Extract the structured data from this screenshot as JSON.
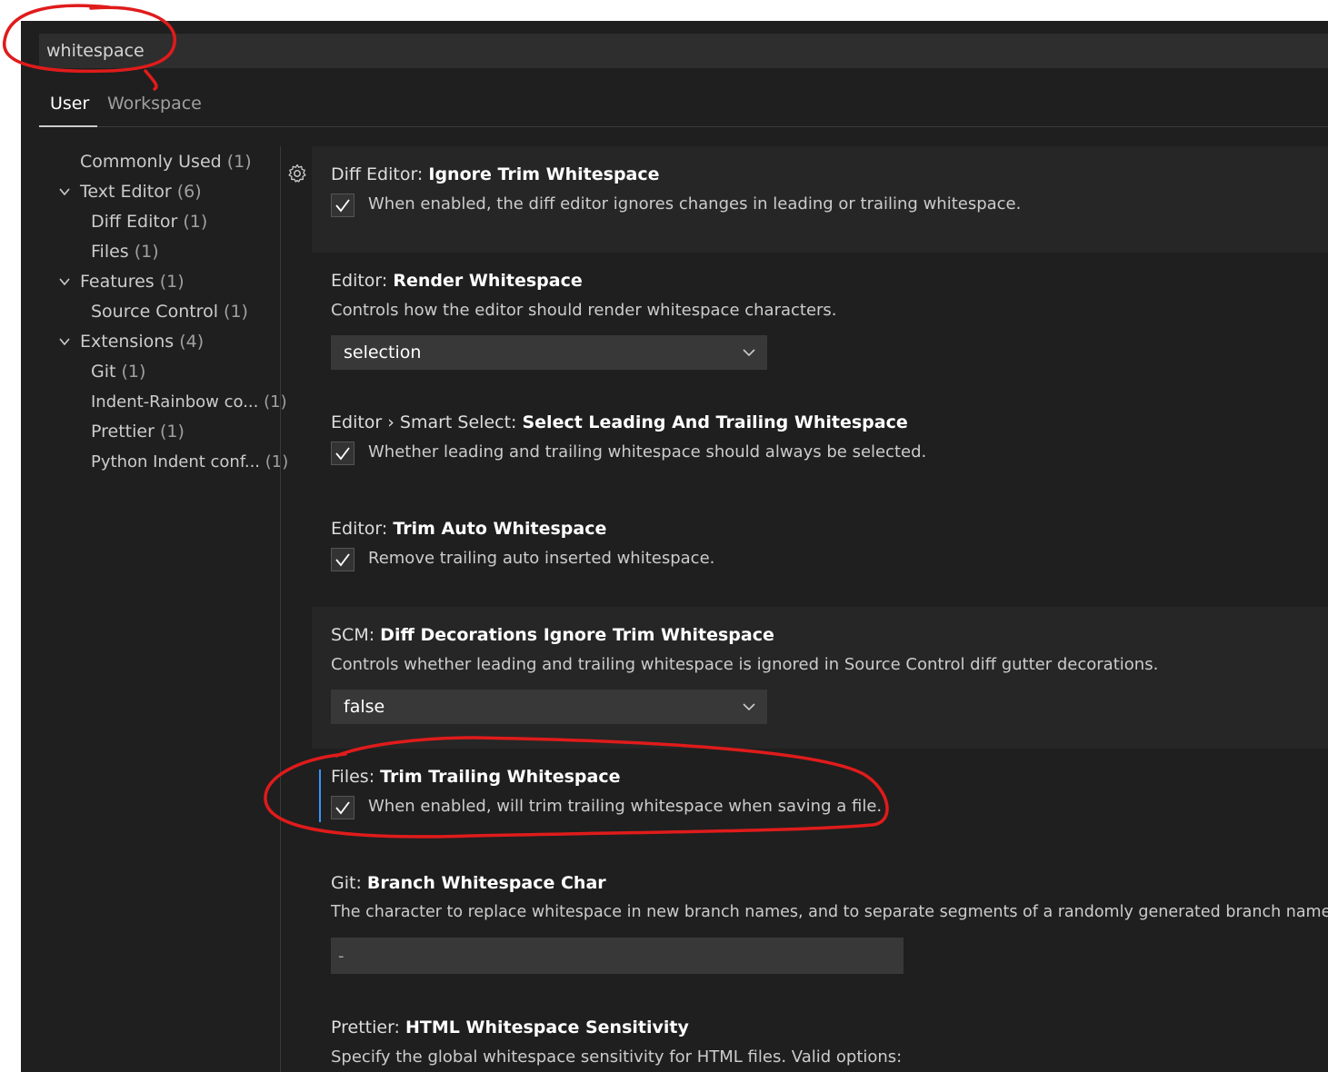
{
  "search": {
    "value": "whitespace"
  },
  "tabs": [
    {
      "label": "User",
      "active": true
    },
    {
      "label": "Workspace",
      "active": false
    }
  ],
  "toc": [
    {
      "label": "Commonly Used",
      "count": "(1)"
    },
    {
      "label": "Text Editor",
      "count": "(6)",
      "expanded": true
    },
    {
      "label": "Diff Editor",
      "count": "(1)"
    },
    {
      "label": "Files",
      "count": "(1)"
    },
    {
      "label": "Features",
      "count": "(1)",
      "expanded": true
    },
    {
      "label": "Source Control",
      "count": "(1)"
    },
    {
      "label": "Extensions",
      "count": "(4)",
      "expanded": true
    },
    {
      "label": "Git",
      "count": "(1)"
    },
    {
      "label": "Indent-Rainbow co...",
      "count": "(1)"
    },
    {
      "label": "Prettier",
      "count": "(1)"
    },
    {
      "label": "Python Indent conf...",
      "count": "(1)"
    }
  ],
  "settings": [
    {
      "category": "Diff Editor:",
      "name": "Ignore Trim Whitespace",
      "description": "When enabled, the diff editor ignores changes in leading or trailing whitespace.",
      "control": "checkbox",
      "checked": true
    },
    {
      "category": "Editor:",
      "name": "Render Whitespace",
      "description": "Controls how the editor should render whitespace characters.",
      "control": "dropdown",
      "value": "selection"
    },
    {
      "category": "Editor › Smart Select:",
      "name": "Select Leading And Trailing Whitespace",
      "description": "Whether leading and trailing whitespace should always be selected.",
      "control": "checkbox",
      "checked": true
    },
    {
      "category": "Editor:",
      "name": "Trim Auto Whitespace",
      "description": "Remove trailing auto inserted whitespace.",
      "control": "checkbox",
      "checked": true
    },
    {
      "category": "SCM:",
      "name": "Diff Decorations Ignore Trim Whitespace",
      "description": "Controls whether leading and trailing whitespace is ignored in Source Control diff gutter decorations.",
      "control": "dropdown",
      "value": "false"
    },
    {
      "category": "Files:",
      "name": "Trim Trailing Whitespace",
      "description": "When enabled, will trim trailing whitespace when saving a file.",
      "control": "checkbox",
      "checked": true
    },
    {
      "category": "Git:",
      "name": "Branch Whitespace Char",
      "description": "The character to replace whitespace in new branch names, and to separate segments of a randomly generated branch name.",
      "control": "text",
      "value": "-"
    },
    {
      "category": "Prettier:",
      "name": "HTML Whitespace Sensitivity",
      "description": "Specify the global whitespace sensitivity for HTML files. Valid options:"
    }
  ],
  "colors": {
    "background": "#1f1f1f",
    "focus_accent": "#3794ff",
    "annotation": "#e01b1b"
  },
  "icons": [
    "gear-icon",
    "chevron-down-icon",
    "check-icon"
  ]
}
